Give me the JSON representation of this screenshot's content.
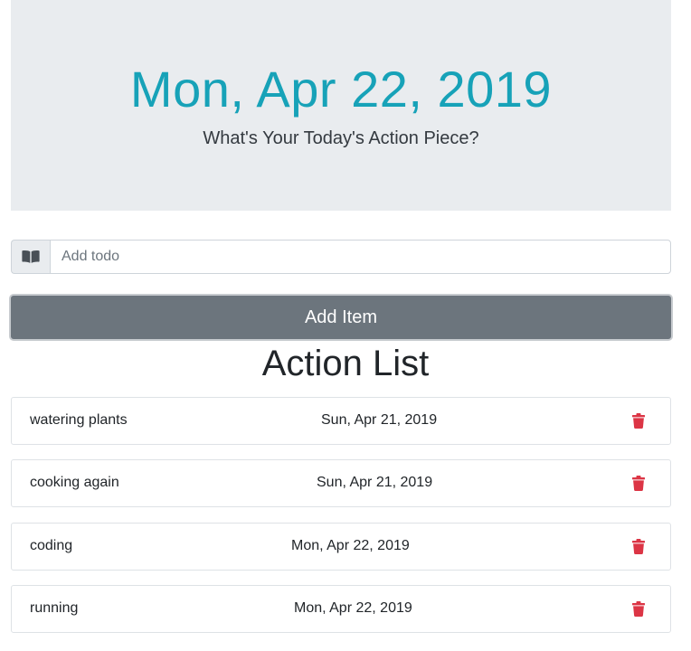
{
  "header": {
    "date": "Mon, Apr 22, 2019",
    "subtitle": "What's Your Today's Action Piece?"
  },
  "form": {
    "prepend_icon": "book-icon",
    "input_placeholder": "Add todo",
    "input_value": "",
    "add_button_label": "Add Item"
  },
  "list": {
    "title": "Action List",
    "items": [
      {
        "name": "watering plants",
        "date": "Sun, Apr 21, 2019",
        "delete_icon": "trash-icon"
      },
      {
        "name": "cooking again",
        "date": "Sun, Apr 21, 2019",
        "delete_icon": "trash-icon"
      },
      {
        "name": "coding",
        "date": "Mon, Apr 22, 2019",
        "delete_icon": "trash-icon"
      },
      {
        "name": "running",
        "date": "Mon, Apr 22, 2019",
        "delete_icon": "trash-icon"
      }
    ]
  },
  "colors": {
    "accent": "#17a2b8",
    "jumbotron_bg": "#e9ecef",
    "button_bg": "#6c757d",
    "danger": "#dc3545"
  }
}
